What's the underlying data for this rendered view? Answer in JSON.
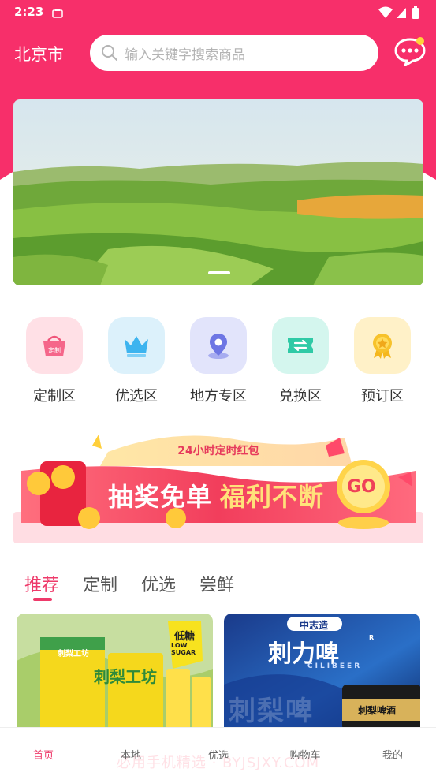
{
  "status_bar": {
    "time": "2:23"
  },
  "header": {
    "city": "北京市",
    "search_placeholder": "输入关键字搜索商品"
  },
  "categories": [
    {
      "label": "定制区",
      "icon": "basket-icon",
      "icon_text": "定制"
    },
    {
      "label": "优选区",
      "icon": "crown-icon"
    },
    {
      "label": "地方专区",
      "icon": "location-pin-icon"
    },
    {
      "label": "兑换区",
      "icon": "exchange-ticket-icon"
    },
    {
      "label": "预订区",
      "icon": "award-medal-icon"
    }
  ],
  "promo": {
    "top_label": "24小时定时红包",
    "title_left": "抽奖免单",
    "title_right": "福利不断",
    "go": "GO",
    "coin_symbol": "¥"
  },
  "tabs": [
    {
      "label": "推荐",
      "active": true
    },
    {
      "label": "定制",
      "active": false
    },
    {
      "label": "优选",
      "active": false
    },
    {
      "label": "尝鲜",
      "active": false
    }
  ],
  "products": [
    {
      "brand": "刺梨工坊",
      "tag": "低糖",
      "tag_sub": "LOW SUGAR",
      "title": "刺梨工坊"
    },
    {
      "badge": "中志造",
      "title": "刺力啤",
      "subtitle": "CILIBEER",
      "mark": "R",
      "bg_text": "刺梨啤",
      "can_label": "刺梨啤酒"
    }
  ],
  "bottom_nav": [
    {
      "label": "首页",
      "active": true
    },
    {
      "label": "本地",
      "active": false
    },
    {
      "label": "优选",
      "active": false
    },
    {
      "label": "购物车",
      "active": false
    },
    {
      "label": "我的",
      "active": false
    }
  ],
  "watermark": "必用手机精选 · BYJSJXY.COM",
  "colors": {
    "brand_pink": "#f72f6a",
    "tab_active": "#ee3a6a",
    "promo_red": "#f04a62",
    "promo_yellow": "#ffd84a"
  }
}
